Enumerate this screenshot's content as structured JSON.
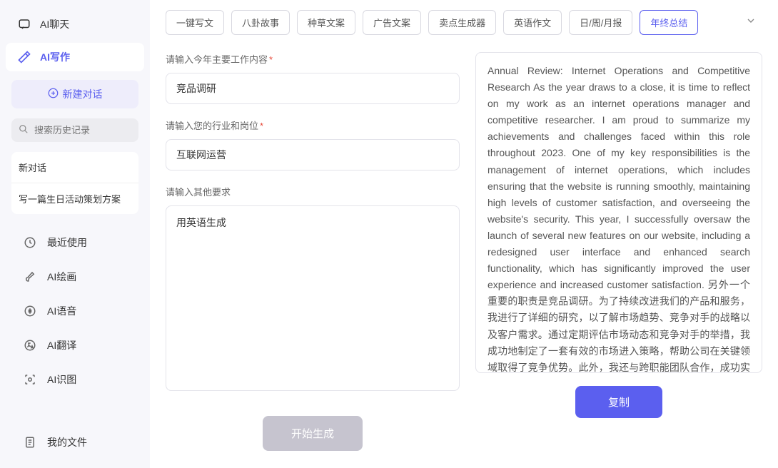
{
  "sidebar": {
    "nav": {
      "chat": "AI聊天",
      "write": "AI写作"
    },
    "new_conv": "新建对话",
    "search_placeholder": "搜索历史记录",
    "history": [
      "新对话",
      "写一篇生日活动策划方案"
    ],
    "tools": {
      "recent": "最近使用",
      "drawing": "AI绘画",
      "voice": "AI语音",
      "translate": "AI翻译",
      "image_rec": "AI识图",
      "files": "我的文件"
    }
  },
  "tabs": [
    "一键写文",
    "八卦故事",
    "种草文案",
    "广告文案",
    "卖点生成器",
    "英语作文",
    "日/周/月报",
    "年终总结"
  ],
  "active_tab_index": 7,
  "form": {
    "field1": {
      "label": "请输入今年主要工作内容",
      "value": "竞品调研"
    },
    "field2": {
      "label": "请输入您的行业和岗位",
      "value": "互联网运营"
    },
    "field3": {
      "label": "请输入其他要求",
      "value": "用英语生成"
    },
    "generate_btn": "开始生成"
  },
  "output": {
    "text": "Annual Review: Internet Operations and Competitive Research As the year draws to a close, it is time to reflect on my work as an internet operations manager and competitive researcher. I am proud to summarize my achievements and challenges faced within this role throughout 2023. One of my key responsibilities is the management of internet operations, which includes ensuring that the website is running smoothly, maintaining high levels of customer satisfaction, and overseeing the website's security. This year, I successfully oversaw the launch of several new features on our website, including a redesigned user interface and enhanced search functionality, which has significantly improved the user experience and increased customer satisfaction. 另外一个重要的职责是竞品调研。为了持续改进我们的产品和服务，我进行了详细的研究，以了解市场趋势、竞争对手的战略以及客户需求。通过定期评估市场动态和竞争对手的举措，我成功地制定了一套有效的市场进入策略，帮助公司在关键领域取得了竞争优势。此外，我还与跨职能团队合作，成功实施了一系列优化措施，以提高我们产品的性能和用户体验。 One of my key achievements this year was the development of a comprehensive c",
    "copy_btn": "复制"
  }
}
